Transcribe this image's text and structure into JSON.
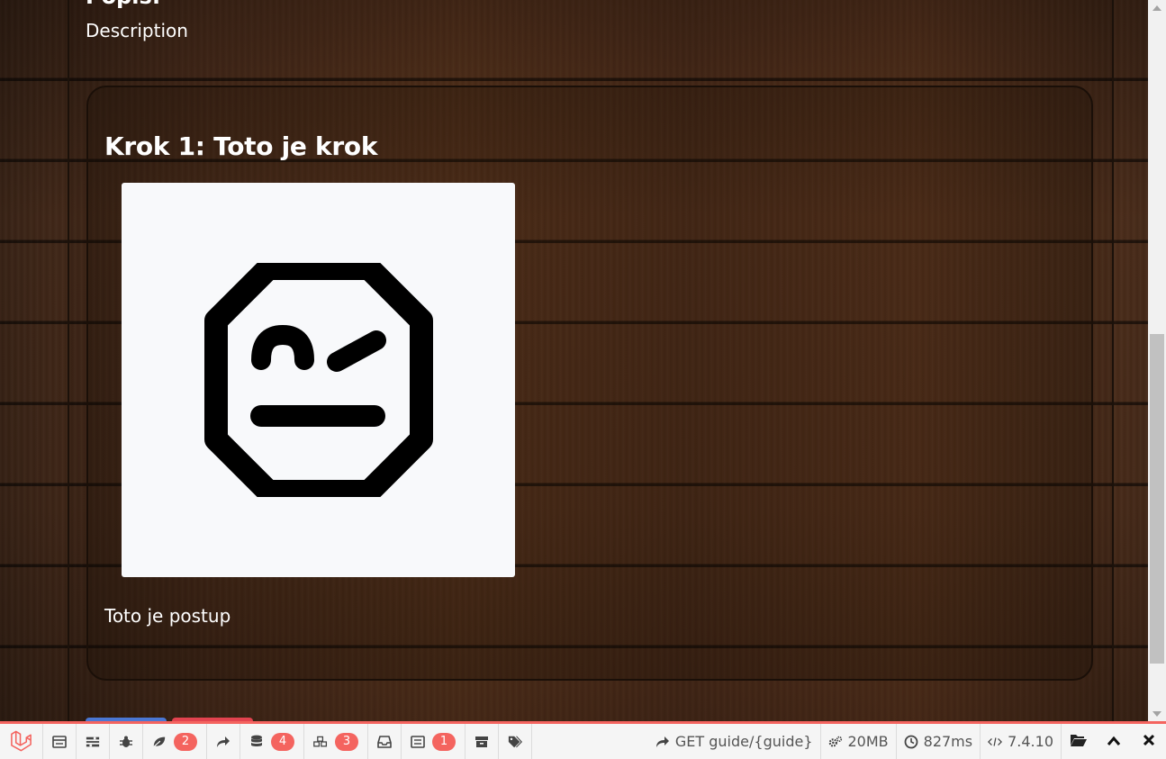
{
  "page": {
    "top_heading": "Popis:",
    "description": "Description",
    "step": {
      "title": "Krok 1: Toto je krok",
      "image_alt_icon": "robot-face-icon",
      "text": "Toto je postup"
    }
  },
  "debugbar": {
    "items": [
      {
        "name": "messages",
        "icon": "message-icon",
        "badge": ""
      },
      {
        "name": "timeline",
        "icon": "timeline-icon",
        "badge": ""
      },
      {
        "name": "exceptions",
        "icon": "bug-icon",
        "badge": ""
      },
      {
        "name": "views",
        "icon": "leaf-icon",
        "badge": "2"
      },
      {
        "name": "route",
        "icon": "share-icon",
        "badge": ""
      },
      {
        "name": "queries",
        "icon": "database-icon",
        "badge": "4"
      },
      {
        "name": "models",
        "icon": "cubes-icon",
        "badge": "3"
      },
      {
        "name": "mails",
        "icon": "inbox-icon",
        "badge": ""
      },
      {
        "name": "gate",
        "icon": "list-icon",
        "badge": "1"
      },
      {
        "name": "session",
        "icon": "archive-icon",
        "badge": ""
      },
      {
        "name": "request",
        "icon": "tags-icon",
        "badge": ""
      }
    ],
    "route": "GET guide/{guide}",
    "memory": "20MB",
    "time": "827ms",
    "php_version": "7.4.10"
  },
  "colors": {
    "accent": "#f4645f",
    "card_border": "#1a0f08",
    "image_bg": "#f8f9fb"
  }
}
